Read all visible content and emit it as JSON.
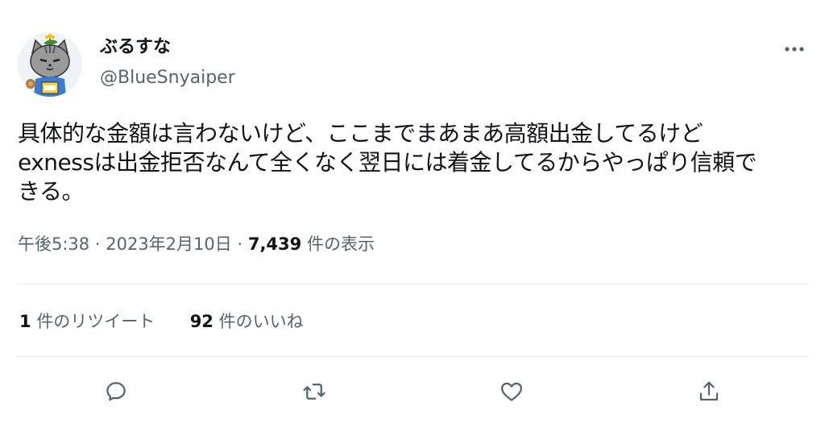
{
  "user": {
    "display_name": "ぶるすな",
    "handle": "@BlueSnyaiper"
  },
  "tweet": {
    "lines": [
      "具体的な金額は言わないけど、ここまでまあまあ高額出金してるけど",
      "exnessは出金拒否なんて全くなく翌日には着金してるからやっぱり信頼で",
      "きる。"
    ]
  },
  "meta": {
    "time": "午後5:38",
    "separator": "·",
    "date": "2023年2月10日",
    "views_count": "7,439",
    "views_label": "件の表示"
  },
  "stats": {
    "retweets_count": "1",
    "retweets_label": "件のリツイート",
    "likes_count": "92",
    "likes_label": "件のいいね"
  },
  "icons": {
    "more": "more-horizontal-icon",
    "reply": "reply-bubble-icon",
    "retweet": "retweet-icon",
    "like": "heart-icon",
    "share": "share-upload-icon"
  },
  "colors": {
    "text_primary": "#0f1419",
    "text_secondary": "#536471",
    "divider": "#e7ecef"
  }
}
